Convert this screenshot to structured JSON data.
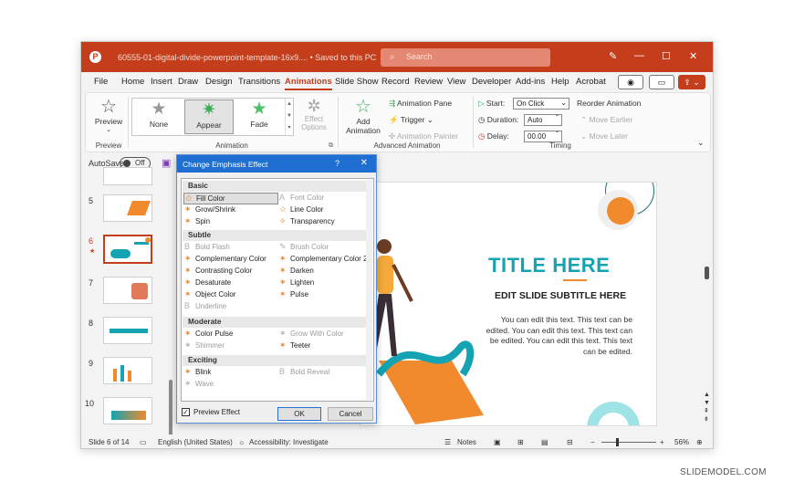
{
  "window": {
    "doc_title": "60555-01-digital-divide-powerpoint-template-16x9....  •  Saved to this PC ⌄",
    "search_placeholder": "Search",
    "min_glyph": "—",
    "max_glyph": "☐",
    "close_glyph": "✕",
    "pen_glyph": "✎"
  },
  "tabs": [
    "File",
    "Home",
    "Insert",
    "Draw",
    "Design",
    "Transitions",
    "Animations",
    "Slide Show",
    "Record",
    "Review",
    "View",
    "Developer",
    "Add-ins",
    "Help",
    "Acrobat"
  ],
  "active_tab": "Animations",
  "ribbon": {
    "preview": {
      "label": "Preview",
      "group": "Preview"
    },
    "animation_items": [
      {
        "label": "None",
        "icon": "star-gray"
      },
      {
        "label": "Appear",
        "icon": "star-green"
      },
      {
        "label": "Fade",
        "icon": "star-green"
      }
    ],
    "effect_options": "Effect Options",
    "animation_group": "Animation",
    "add_animation": "Add Animation",
    "animation_pane": "Animation Pane",
    "trigger": "Trigger",
    "animation_painter": "Animation Painter",
    "advanced_group": "Advanced Animation",
    "start_label": "Start:",
    "start_value": "On Click",
    "duration_label": "Duration:",
    "duration_value": "Auto",
    "delay_label": "Delay:",
    "delay_value": "00.00",
    "reorder": "Reorder Animation",
    "move_earlier": "Move Earlier",
    "move_later": "Move Later",
    "timing_group": "Timing"
  },
  "autosave": {
    "label": "AutoSave",
    "state": "Off"
  },
  "thumbnails": [
    {
      "num": "5",
      "current": false
    },
    {
      "num": "6",
      "current": true
    },
    {
      "num": "7",
      "current": false
    },
    {
      "num": "8",
      "current": false
    },
    {
      "num": "9",
      "current": false
    },
    {
      "num": "10",
      "current": false
    }
  ],
  "slide": {
    "title": "TITLE HERE",
    "subtitle": "EDIT SLIDE SUBTITLE HERE",
    "body": "You can edit this text. This text can be edited. You can edit this text. This text can be edited. You can edit this text. This text can be edited.",
    "accent": "#13a3b2",
    "orange": "#f08a2c"
  },
  "dialog": {
    "title": "Change Emphasis Effect",
    "help": "?",
    "close": "✕",
    "categories": {
      "basic": "Basic",
      "subtle": "Subtle",
      "moderate": "Moderate",
      "exciting": "Exciting"
    },
    "basic": [
      {
        "label": "Fill Color",
        "enabled": true,
        "selected": true
      },
      {
        "label": "Font Color",
        "enabled": false
      },
      {
        "label": "Grow/Shrink",
        "enabled": true
      },
      {
        "label": "Line Color",
        "enabled": true
      },
      {
        "label": "Spin",
        "enabled": true
      },
      {
        "label": "Transparency",
        "enabled": true
      }
    ],
    "subtle": [
      {
        "label": "Bold Flash",
        "enabled": false
      },
      {
        "label": "Brush Color",
        "enabled": false
      },
      {
        "label": "Complementary Color",
        "enabled": true
      },
      {
        "label": "Complementary Color 2",
        "enabled": true
      },
      {
        "label": "Contrasting Color",
        "enabled": true
      },
      {
        "label": "Darken",
        "enabled": true
      },
      {
        "label": "Desaturate",
        "enabled": true
      },
      {
        "label": "Lighten",
        "enabled": true
      },
      {
        "label": "Object Color",
        "enabled": true
      },
      {
        "label": "Pulse",
        "enabled": true
      },
      {
        "label": "Underline",
        "enabled": false
      }
    ],
    "moderate": [
      {
        "label": "Color Pulse",
        "enabled": true
      },
      {
        "label": "Grow With Color",
        "enabled": false
      },
      {
        "label": "Shimmer",
        "enabled": false
      },
      {
        "label": "Teeter",
        "enabled": true
      }
    ],
    "exciting": [
      {
        "label": "Blink",
        "enabled": true
      },
      {
        "label": "Bold Reveal",
        "enabled": false
      },
      {
        "label": "Wave",
        "enabled": false
      }
    ],
    "preview_effect": "Preview Effect",
    "preview_checked": true,
    "ok": "OK",
    "cancel": "Cancel"
  },
  "status": {
    "slide_info": "Slide 6 of 14",
    "language": "English (United States)",
    "accessibility": "Accessibility: Investigate",
    "notes": "Notes",
    "zoom": "56%"
  },
  "watermark": "SLIDEMODEL.COM"
}
